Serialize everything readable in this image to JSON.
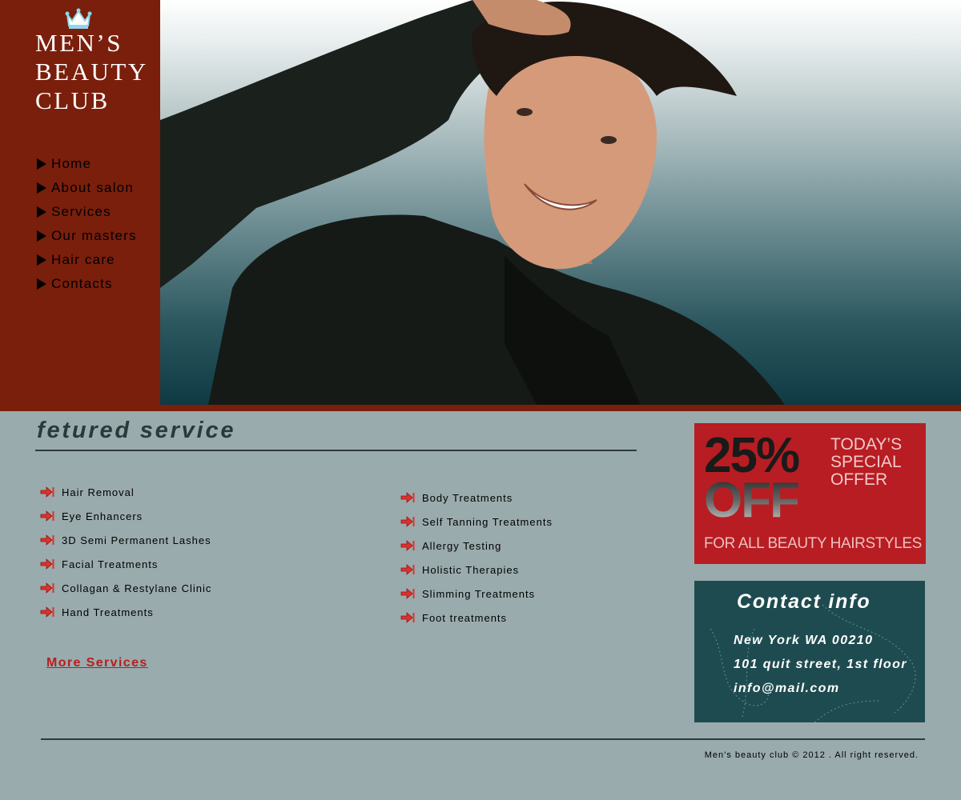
{
  "brand": {
    "line1": "MEN’S",
    "line2": "BEAUTY",
    "line3": "CLUB",
    "accent_color": "#7a1f0c"
  },
  "nav": {
    "items": [
      {
        "label": "Home"
      },
      {
        "label": "About salon"
      },
      {
        "label": "Services"
      },
      {
        "label": "Our masters"
      },
      {
        "label": "Hair care"
      },
      {
        "label": "Contacts"
      }
    ]
  },
  "featured": {
    "title": "fetured service",
    "left_items": [
      {
        "label": "Hair Removal"
      },
      {
        "label": "Eye Enhancers"
      },
      {
        "label": "3D Semi Permanent Lashes"
      },
      {
        "label": "Facial Treatments"
      },
      {
        "label": "Collagan & Restylane Clinic"
      },
      {
        "label": "Hand Treatments"
      }
    ],
    "right_items": [
      {
        "label": "Body Treatments"
      },
      {
        "label": "Self Tanning Treatments"
      },
      {
        "label": "Allergy Testing"
      },
      {
        "label": "Holistic Therapies"
      },
      {
        "label": "Slimming Treatments"
      },
      {
        "label": "Foot treatments"
      }
    ],
    "more_link": "More Services",
    "item_icon": "red-arrow-icon"
  },
  "promo": {
    "percent": "25%",
    "off": "OFF",
    "today": "TODAY’S\nSPECIAL\nOFFER",
    "bottom": "FOR ALL BEAUTY HAIRSTYLES",
    "bg_color": "#b71d22"
  },
  "contact": {
    "title": "Contact info",
    "line1": "New York WA 00210",
    "line2": "101 quit street, 1st floor",
    "line3": "info@mail.com",
    "bg_color": "#1e4b4f"
  },
  "footer": {
    "copyright": "Men’s beauty club © 2012 . All right reserved."
  }
}
